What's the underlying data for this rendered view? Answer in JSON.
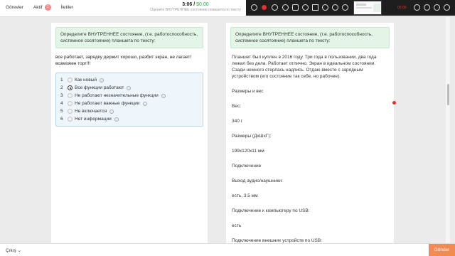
{
  "nav": {
    "tabs": [
      {
        "label": "Görevler"
      },
      {
        "label": "Aktif",
        "badge": "1"
      },
      {
        "label": "İletiler"
      }
    ]
  },
  "timer": {
    "time": "3:06",
    "separator": " / ",
    "reward": "$0,00",
    "subtitle": "Оцените ВНУТРЕННЕЕ состояние планшета по тексту"
  },
  "recorder": {
    "timecode": "00:00"
  },
  "left_panel": {
    "instruction": "Определите ВНУТРЕННЕЕ состояние, (т.е. работоспособность, системное сосятояние) планшета по тексту:",
    "text": [
      "все работает, зарядку держит хорошо, разбит экран, не лагает!",
      "возможен торг!!!"
    ],
    "options": [
      {
        "num": "1",
        "label": "Как новый",
        "selected": false
      },
      {
        "num": "2",
        "label": "Все функции работают",
        "selected": true
      },
      {
        "num": "3",
        "label": "Не работают незначительные функции",
        "selected": false
      },
      {
        "num": "4",
        "label": "Не работают важные функции",
        "selected": false
      },
      {
        "num": "5",
        "label": "Не включается",
        "selected": false
      },
      {
        "num": "6",
        "label": "Нет информации",
        "selected": false
      }
    ]
  },
  "right_panel": {
    "instruction": "Определите ВНУТРЕННЕЕ состояние, (т.е. работоспособность, системное сосятояние) планшета по тексту:",
    "paragraphs": [
      "Планшет был куплен в 2016 году. Три года в пользовании, два года лежал без дела. Работает отлично. Экран в идеальном состоянии. Сзади немного стерлась надпись. Отдаю вместе с зарядным устройством (его состояние так себе, но рабочее).",
      "Размеры и вес",
      "Вес:",
      "340 г",
      "Размеры (ДхШхГ):",
      "199x120x11 мм",
      "Подключение",
      "Выход аудио/наушники:",
      "есть, 3.5 мм",
      "Подключение к компьютеру по USB:",
      "есть",
      "Подключение внешних устройств по USB:"
    ]
  },
  "bottom": {
    "exit_label": "Çıkış",
    "exit_icon": "chevron-down-icon",
    "submit_label": "Gönder"
  },
  "colors": {
    "accent_orange": "#f28a52",
    "instruction_bg": "#e2f5e7",
    "options_bg": "#eef6fc",
    "badge": "#f28b8b",
    "reward_green": "#2fa84f"
  }
}
